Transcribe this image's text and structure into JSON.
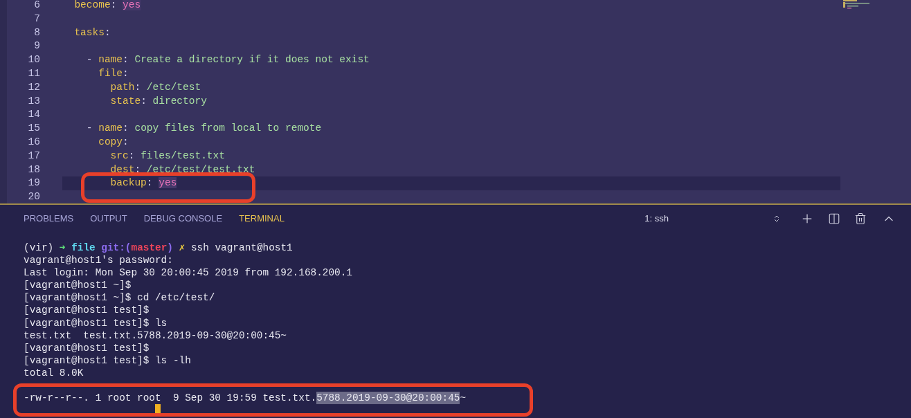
{
  "editor": {
    "lines": [
      {
        "number": "6",
        "current": false,
        "tokens": [
          {
            "text": "  become",
            "kind": "key"
          },
          {
            "text": ": ",
            "kind": "punct"
          },
          {
            "text": "yes",
            "kind": "bool"
          }
        ]
      },
      {
        "number": "7",
        "current": false
      },
      {
        "number": "8",
        "current": false,
        "tokens": [
          {
            "text": "  tasks",
            "kind": "key"
          },
          {
            "text": ":",
            "kind": "punct"
          }
        ]
      },
      {
        "number": "9",
        "current": false
      },
      {
        "number": "10",
        "current": false,
        "tokens": [
          {
            "text": "    - ",
            "kind": "punct"
          },
          {
            "text": "name",
            "kind": "key"
          },
          {
            "text": ": ",
            "kind": "punct"
          },
          {
            "text": "Create a directory if it does not exist",
            "kind": "string"
          }
        ]
      },
      {
        "number": "11",
        "current": false,
        "tokens": [
          {
            "text": "      file",
            "kind": "key"
          },
          {
            "text": ":",
            "kind": "punct"
          }
        ]
      },
      {
        "number": "12",
        "current": false,
        "tokens": [
          {
            "text": "        path",
            "kind": "key"
          },
          {
            "text": ": ",
            "kind": "punct"
          },
          {
            "text": "/etc/test",
            "kind": "string"
          }
        ]
      },
      {
        "number": "13",
        "current": false,
        "tokens": [
          {
            "text": "        state",
            "kind": "key"
          },
          {
            "text": ": ",
            "kind": "punct"
          },
          {
            "text": "directory",
            "kind": "string"
          }
        ]
      },
      {
        "number": "14",
        "current": false
      },
      {
        "number": "15",
        "current": false,
        "tokens": [
          {
            "text": "    - ",
            "kind": "punct"
          },
          {
            "text": "name",
            "kind": "key"
          },
          {
            "text": ": ",
            "kind": "punct"
          },
          {
            "text": "copy files from local to remote",
            "kind": "string"
          }
        ]
      },
      {
        "number": "16",
        "current": false,
        "tokens": [
          {
            "text": "      copy",
            "kind": "key"
          },
          {
            "text": ":",
            "kind": "punct"
          }
        ]
      },
      {
        "number": "17",
        "current": false,
        "tokens": [
          {
            "text": "        src",
            "kind": "key"
          },
          {
            "text": ": ",
            "kind": "punct"
          },
          {
            "text": "files/test.txt",
            "kind": "string"
          }
        ]
      },
      {
        "number": "18",
        "current": false,
        "tokens": [
          {
            "text": "        dest",
            "kind": "key"
          },
          {
            "text": ": ",
            "kind": "punct"
          },
          {
            "text": "/etc/test/test.txt",
            "kind": "string"
          }
        ]
      },
      {
        "number": "19",
        "current": true,
        "tokens": [
          {
            "text": "        backup",
            "kind": "key"
          },
          {
            "text": ": ",
            "kind": "punct"
          },
          {
            "text": "yes",
            "kind": "bool"
          }
        ]
      },
      {
        "number": "20",
        "current": false
      }
    ]
  },
  "panel": {
    "tabs": [
      {
        "label": "PROBLEMS",
        "selected": false
      },
      {
        "label": "OUTPUT",
        "selected": false
      },
      {
        "label": "DEBUG CONSOLE",
        "selected": false
      },
      {
        "label": "TERMINAL",
        "selected": true
      }
    ],
    "terminal_select": "1: ssh",
    "terminal": {
      "lines": [
        {
          "segments": [
            {
              "text": "(vir) ",
              "kind": "plain"
            },
            {
              "text": "➜ ",
              "kind": "arrow"
            },
            {
              "text": "file ",
              "kind": "dir"
            },
            {
              "text": "git:(",
              "kind": "git"
            },
            {
              "text": "master",
              "kind": "branch"
            },
            {
              "text": ")",
              "kind": "git"
            },
            {
              "text": " ✗ ",
              "kind": "dirty"
            },
            {
              "text": "ssh vagrant@host1",
              "kind": "plain"
            }
          ]
        },
        {
          "segments": [
            {
              "text": "vagrant@host1's password:",
              "kind": "plain"
            }
          ]
        },
        {
          "segments": [
            {
              "text": "Last login: Mon Sep 30 20:00:45 2019 from 192.168.200.1",
              "kind": "plain"
            }
          ]
        },
        {
          "segments": [
            {
              "text": "[vagrant@host1 ~]$",
              "kind": "plain"
            }
          ]
        },
        {
          "segments": [
            {
              "text": "[vagrant@host1 ~]$ cd /etc/test/",
              "kind": "plain"
            }
          ]
        },
        {
          "segments": [
            {
              "text": "[vagrant@host1 test]$",
              "kind": "plain"
            }
          ]
        },
        {
          "segments": [
            {
              "text": "[vagrant@host1 test]$ ls",
              "kind": "plain"
            }
          ]
        },
        {
          "segments": [
            {
              "text": "test.txt  test.txt.5788.2019-09-30@20:00:45~",
              "kind": "plain"
            }
          ]
        },
        {
          "segments": [
            {
              "text": "[vagrant@host1 test]$",
              "kind": "plain"
            }
          ]
        },
        {
          "segments": [
            {
              "text": "[vagrant@host1 test]$ ls -lh",
              "kind": "plain"
            }
          ]
        },
        {
          "segments": [
            {
              "text": "total 8.0K",
              "kind": "plain"
            }
          ]
        },
        {
          "segments": [
            {
              "text": "-rw-r--r--. 1 root root  9 Sep 30 19:59 test.txt.",
              "kind": "plain"
            },
            {
              "text": "5788.2019-09-30@20:00:45",
              "kind": "selected"
            },
            {
              "text": "~",
              "kind": "plain"
            }
          ]
        },
        {
          "cursor": true
        }
      ]
    }
  }
}
